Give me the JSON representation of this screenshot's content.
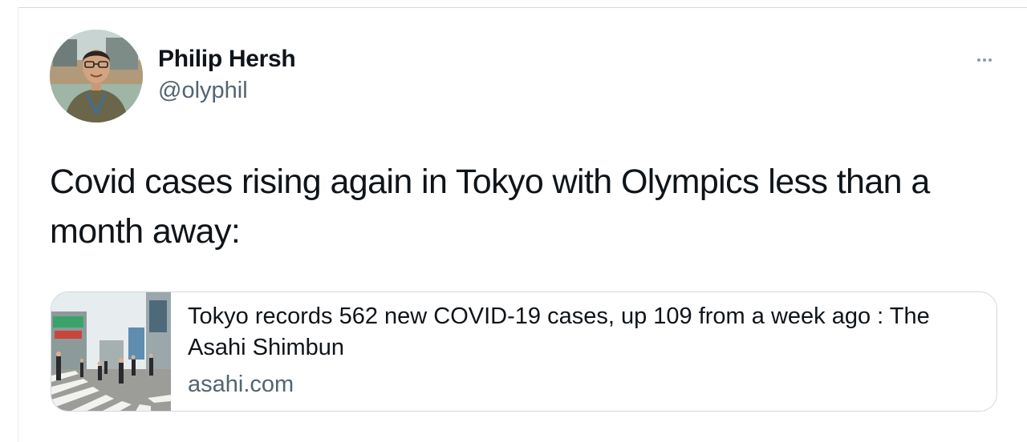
{
  "tweet": {
    "author_name": "Philip Hersh",
    "author_handle": "@olyphil",
    "text": "Covid cases rising again in Tokyo with Olympics less than a month away:",
    "more_icon": "more-horizontal-icon"
  },
  "link_card": {
    "title": "Tokyo records 562 new COVID-19 cases, up 109 from a week ago : The Asahi Shimbun",
    "domain": "asahi.com"
  },
  "colors": {
    "text_primary": "#0f1419",
    "text_secondary": "#536471",
    "border": "#cfd9de",
    "icon_gray": "#8f9aa3"
  }
}
